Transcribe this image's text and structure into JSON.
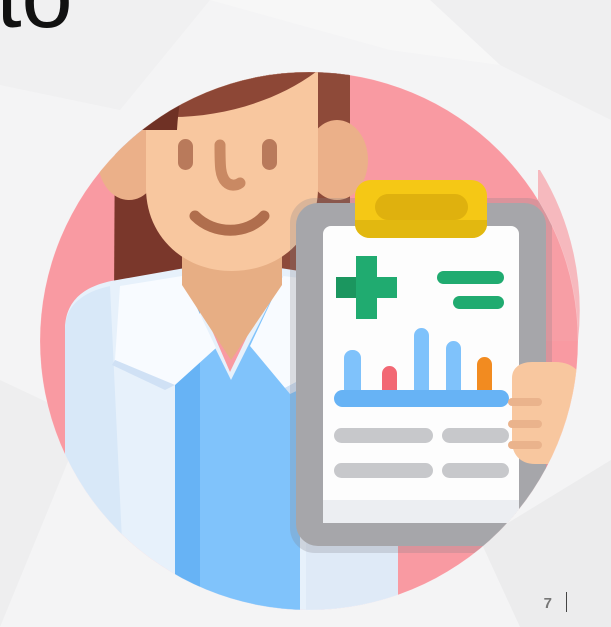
{
  "slide": {
    "title_fragment": "to",
    "page_number": "7",
    "illustration_label": "doctor-holding-medical-report"
  },
  "colors": {
    "background": "#f4f4f5",
    "circle": "#f99aa2",
    "hair": "#8c4738",
    "skin": "#f5c69d",
    "coat": "#e9f2fb",
    "scrubs": "#7ec0f7",
    "clipboard": "#9f9f9f",
    "clip": "#f1c40f",
    "cross": "#22ad72",
    "bar_blue": "#7ec0f7",
    "bar_red": "#f06b73",
    "bar_orange": "#f28c22"
  }
}
